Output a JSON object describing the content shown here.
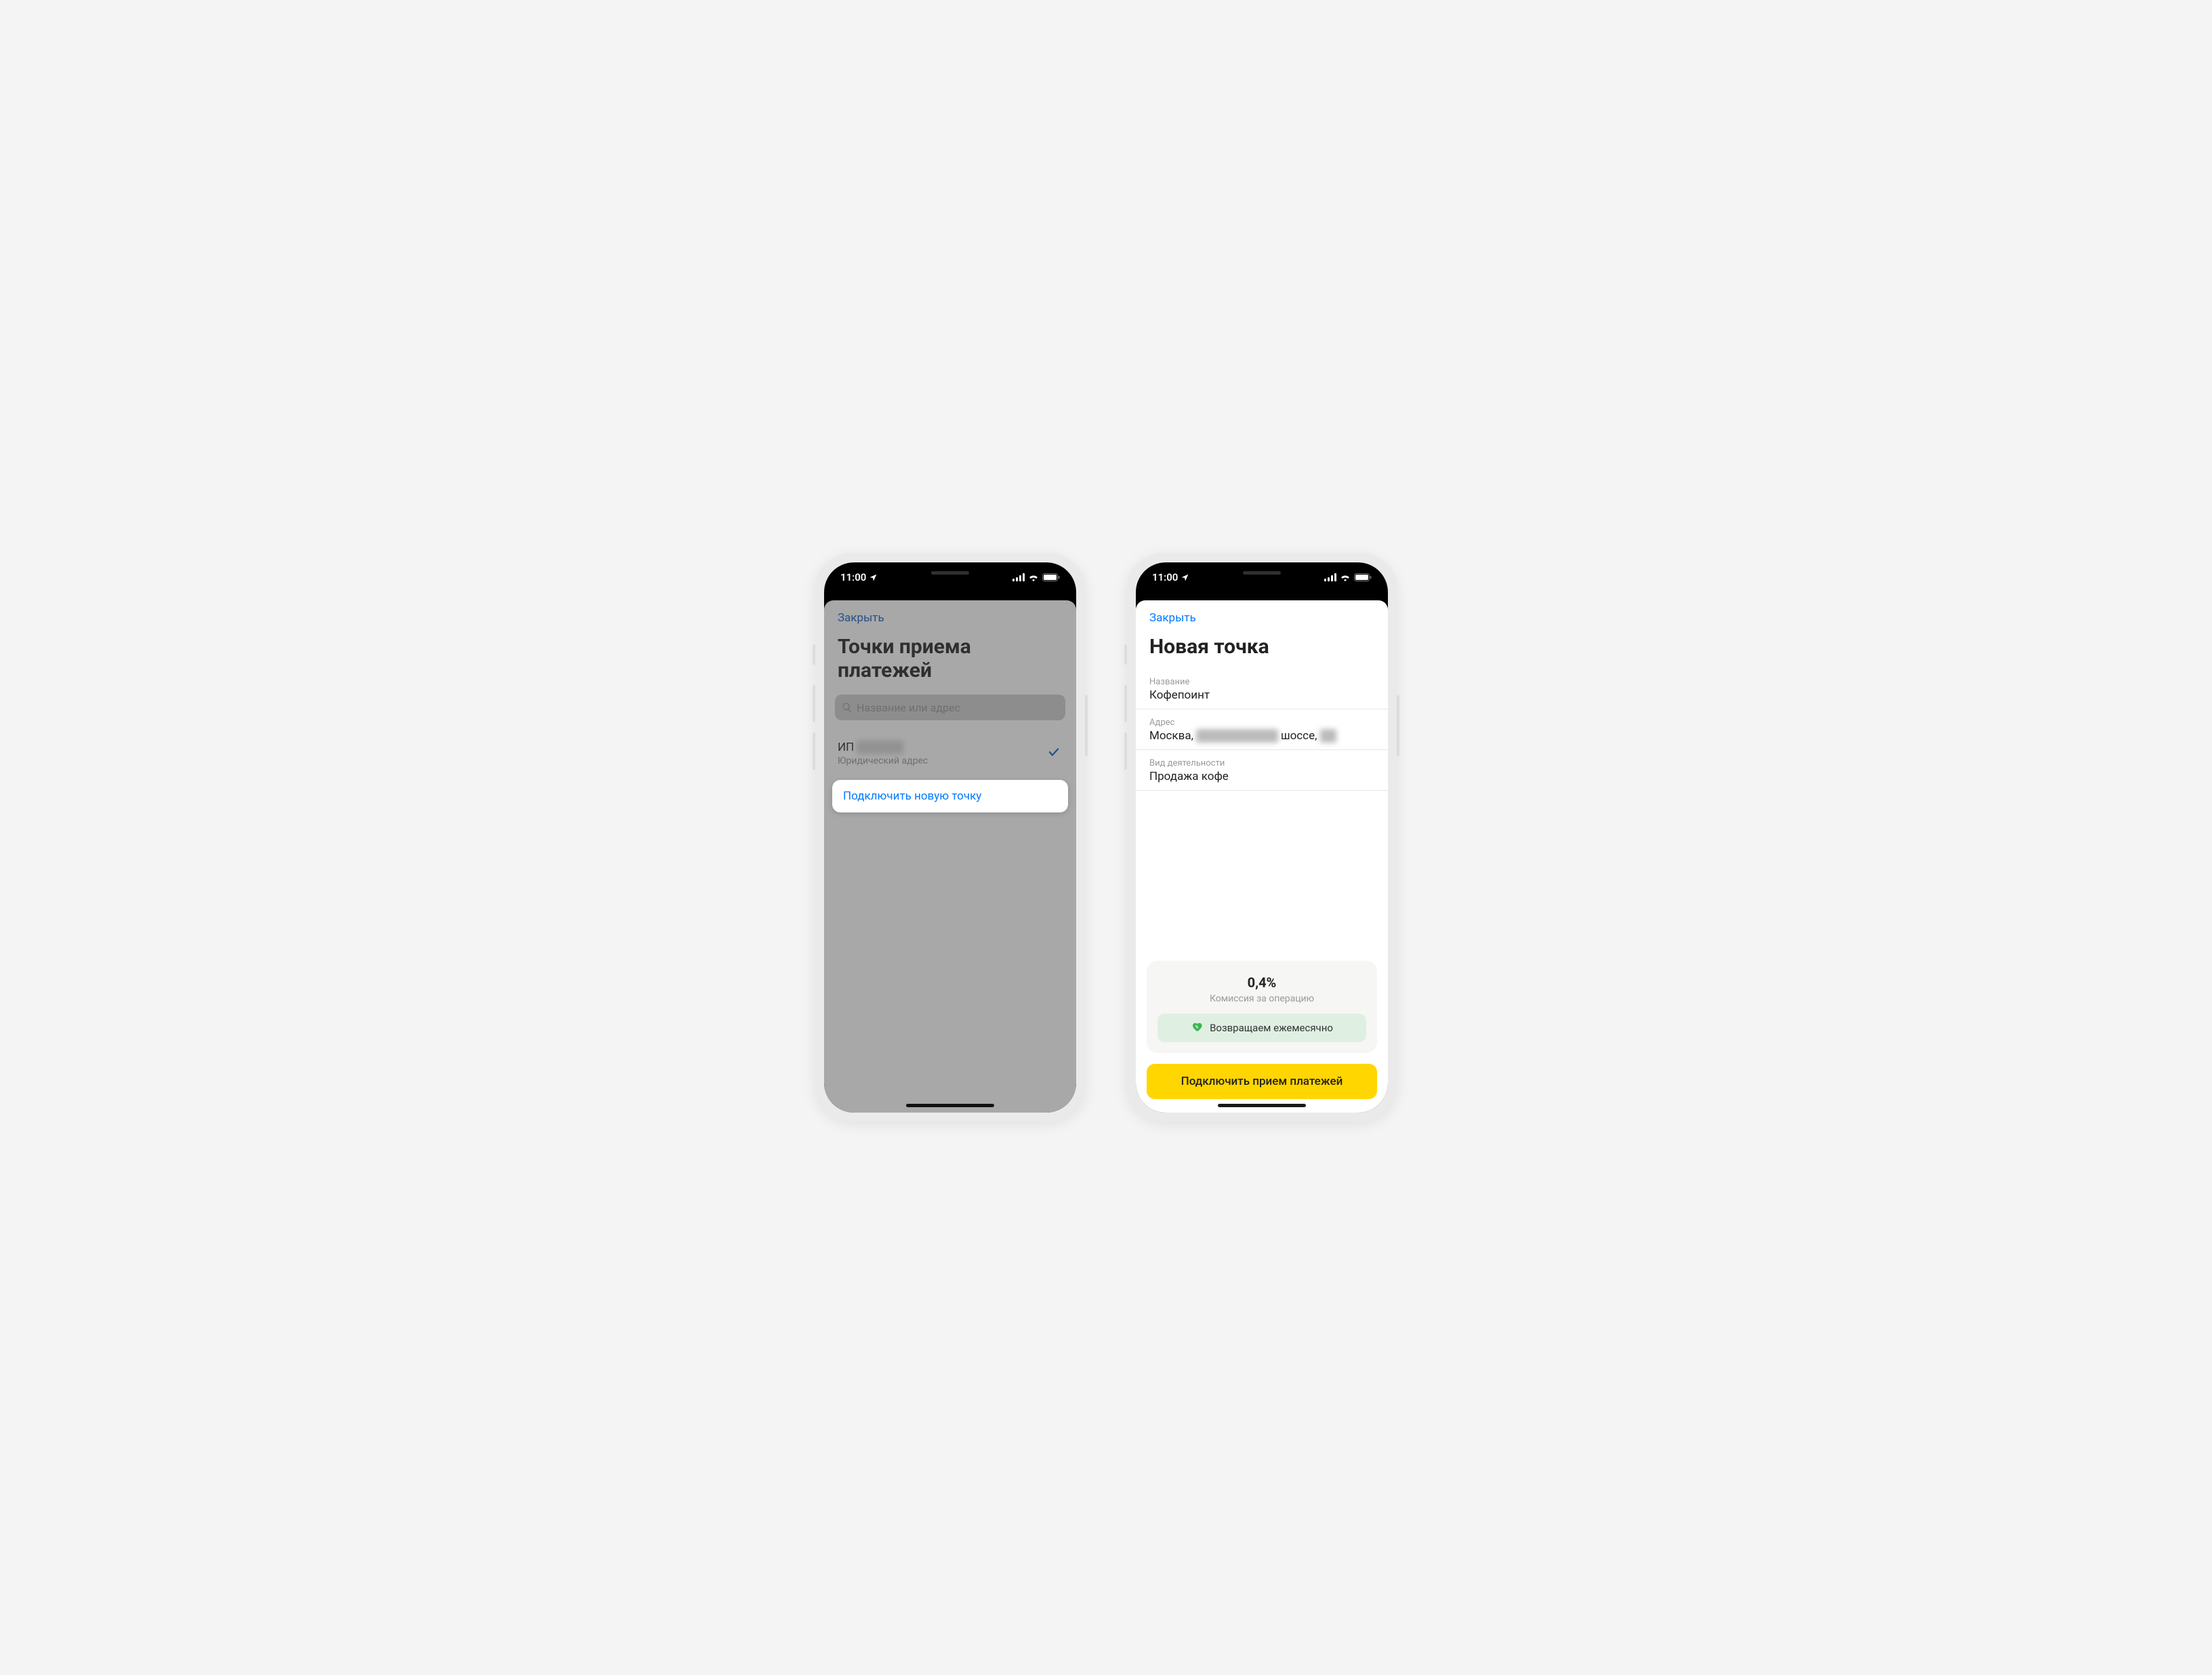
{
  "statusbar": {
    "time": "11:00"
  },
  "phone1": {
    "close": "Закрыть",
    "title": "Точки приема платежей",
    "search_placeholder": "Название или адрес",
    "item": {
      "primary_prefix": "ИП",
      "primary_redacted": "████ █.",
      "secondary": "Юридический адрес"
    },
    "action": "Подключить новую точку"
  },
  "phone2": {
    "close": "Закрыть",
    "title": "Новая точка",
    "fields": {
      "name_label": "Название",
      "name_value": "Кофепоинт",
      "address_label": "Адрес",
      "address_prefix": "Москва, ",
      "address_redacted1": "██████████",
      "address_mid": " шоссе, ",
      "address_redacted2": "██",
      "activity_label": "Вид деятельности",
      "activity_value": "Продажа кофе"
    },
    "promo": {
      "rate": "0,4%",
      "sub": "Комиссия за операцию",
      "chip": "Возвращаем ежемесячно"
    },
    "primary_button": "Подключить прием платежей"
  }
}
